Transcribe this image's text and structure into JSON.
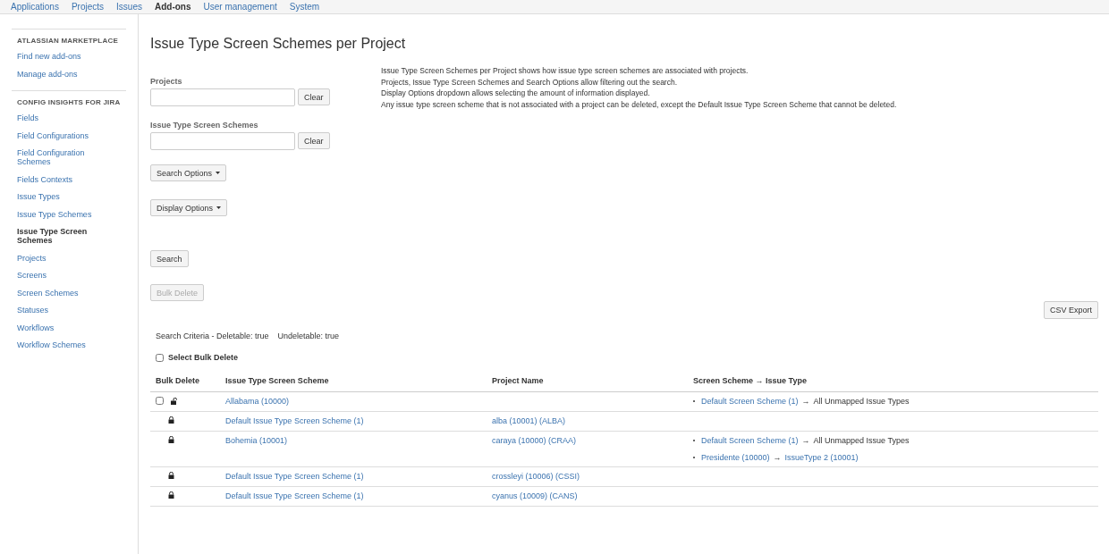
{
  "top_nav": [
    {
      "label": "Applications",
      "selected": false
    },
    {
      "label": "Projects",
      "selected": false
    },
    {
      "label": "Issues",
      "selected": false
    },
    {
      "label": "Add-ons",
      "selected": true
    },
    {
      "label": "User management",
      "selected": false
    },
    {
      "label": "System",
      "selected": false
    }
  ],
  "sidebar": {
    "sections": [
      {
        "heading": "ATLASSIAN MARKETPLACE",
        "items": [
          {
            "label": "Find new add-ons",
            "selected": false
          },
          {
            "label": "Manage add-ons",
            "selected": false
          }
        ]
      },
      {
        "heading": "CONFIG INSIGHTS FOR JIRA",
        "items": [
          {
            "label": "Fields",
            "selected": false
          },
          {
            "label": "Field Configurations",
            "selected": false
          },
          {
            "label": "Field Configuration Schemes",
            "selected": false
          },
          {
            "label": "Fields Contexts",
            "selected": false
          },
          {
            "label": "Issue Types",
            "selected": false
          },
          {
            "label": "Issue Type Schemes",
            "selected": false
          },
          {
            "label": "Issue Type Screen Schemes",
            "selected": true
          },
          {
            "label": "Projects",
            "selected": false
          },
          {
            "label": "Screens",
            "selected": false
          },
          {
            "label": "Screen Schemes",
            "selected": false
          },
          {
            "label": "Statuses",
            "selected": false
          },
          {
            "label": "Workflows",
            "selected": false
          },
          {
            "label": "Workflow Schemes",
            "selected": false
          }
        ]
      }
    ]
  },
  "page_title": "Issue Type Screen Schemes per Project",
  "filters": [
    {
      "label": "Projects",
      "clear": "Clear"
    },
    {
      "label": "Issue Type Screen Schemes",
      "clear": "Clear"
    }
  ],
  "description": [
    "Issue Type Screen Schemes per Project shows how issue type screen schemes are associated with projects.",
    "Projects, Issue Type Screen Schemes and Search Options allow filtering out the search.",
    "Display Options dropdown allows selecting the amount of information displayed.",
    "Any issue type screen scheme that is not associated with a project can be deleted, except the Default Issue Type Screen Scheme that cannot be deleted."
  ],
  "dropdowns": [
    "Search Options",
    "Display Options"
  ],
  "search_button": "Search",
  "bulk_delete_button": {
    "label": "Bulk Delete",
    "disabled": true
  },
  "csv_export": "CSV Export",
  "search_criteria": [
    "Search Criteria - Deletable: true",
    "Undeletable: true"
  ],
  "select_bulk_delete": {
    "label": "Select Bulk Delete",
    "checked": false
  },
  "table": {
    "columns": [
      "Bulk Delete",
      "Issue Type Screen Scheme",
      "Project Name",
      "Screen Scheme → Issue Type"
    ],
    "rows": [
      {
        "deletable": true,
        "checked": false,
        "scheme": "Allabama (10000)",
        "project": "",
        "mappings": [
          {
            "screen_scheme": "Default Screen Scheme (1)",
            "arrow": "→",
            "issue_type": "All Unmapped Issue Types",
            "kind": "plain"
          }
        ]
      },
      {
        "deletable": false,
        "scheme": "Default Issue Type Screen Scheme (1)",
        "project": "alba (10001) (ALBA)",
        "mappings": []
      },
      {
        "deletable": false,
        "scheme": "Bohemia (10001)",
        "project": "caraya (10000) (CRAA)",
        "mappings": [
          {
            "screen_scheme": "Default Screen Scheme (1)",
            "arrow": "→",
            "issue_type": "All Unmapped Issue Types",
            "kind": "plain"
          },
          {
            "screen_scheme": "Presidente (10000)",
            "arrow": "→",
            "issue_type": "IssueType 2 (10001)",
            "kind": "link"
          }
        ]
      },
      {
        "deletable": false,
        "scheme": "Default Issue Type Screen Scheme (1)",
        "project": "crossleyi (10006) (CSSI)",
        "mappings": []
      },
      {
        "deletable": false,
        "scheme": "Default Issue Type Screen Scheme (1)",
        "project": "cyanus (10009) (CANS)",
        "mappings": []
      }
    ]
  }
}
